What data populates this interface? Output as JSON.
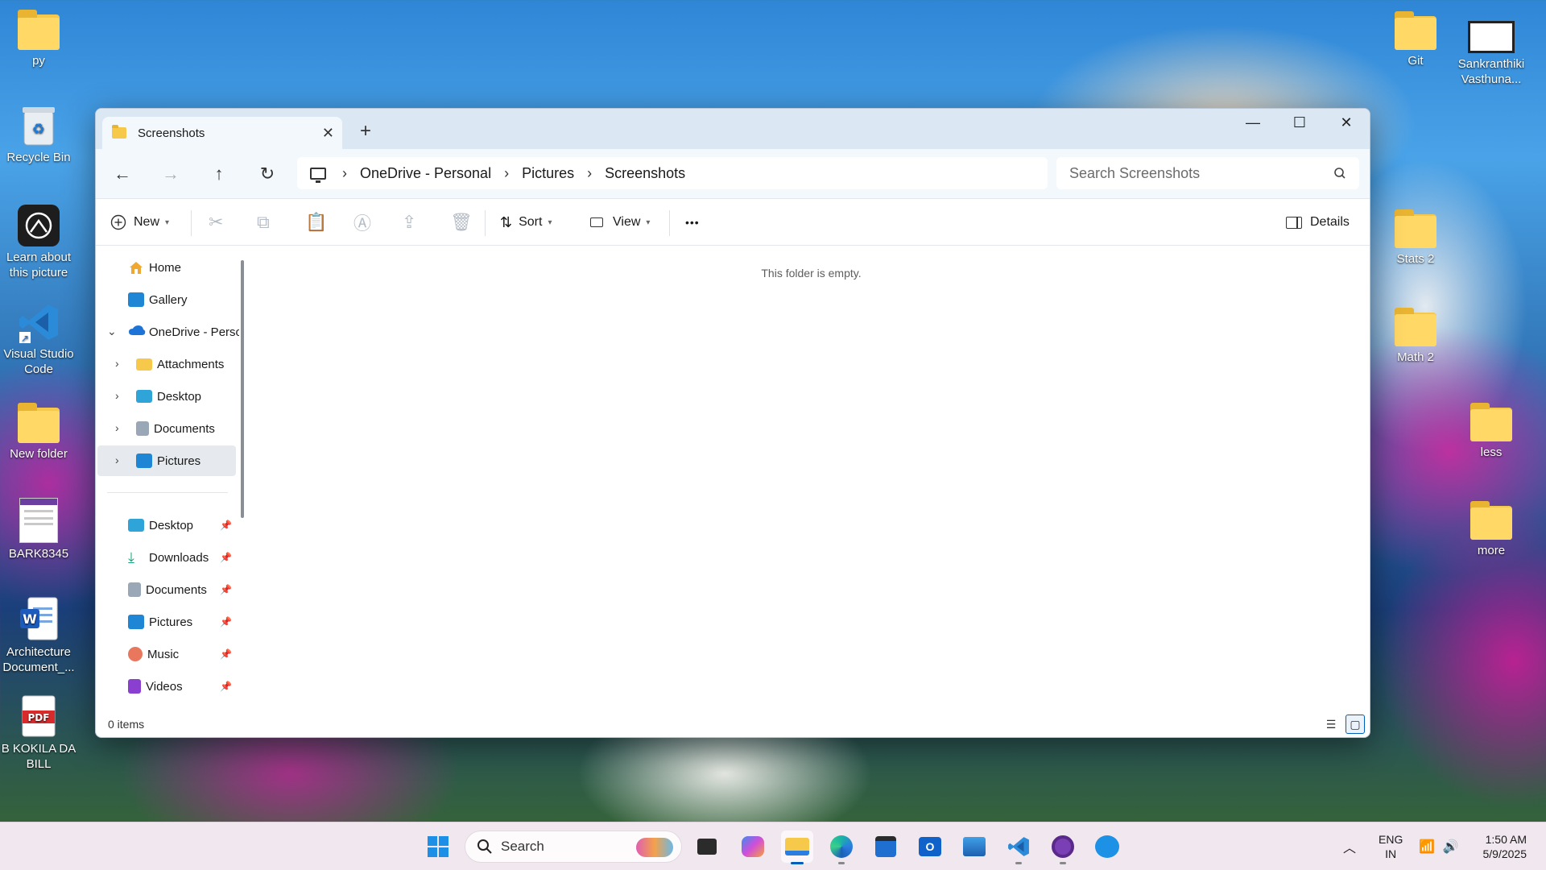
{
  "desktop": {
    "left_icons": [
      {
        "label": "py",
        "icon": "folder-icon"
      },
      {
        "label": "Recycle Bin",
        "icon": "recycle-bin-icon"
      },
      {
        "label": "Learn about this picture",
        "icon": "camera-icon"
      },
      {
        "label": "Visual Studio Code",
        "icon": "vscode-icon"
      },
      {
        "label": "New folder",
        "icon": "folder-icon"
      },
      {
        "label": "BARK8345",
        "icon": "document-thumbnail-icon"
      },
      {
        "label": "Architecture Document_...",
        "icon": "word-icon"
      },
      {
        "label": "B KOKILA DA BILL",
        "icon": "pdf-icon"
      }
    ],
    "right_icons": [
      {
        "label": "Git",
        "icon": "folder-icon"
      },
      {
        "label": "Sankranthiki Vasthuna...",
        "icon": "video-icon"
      },
      {
        "label": "Stats 2",
        "icon": "folder-icon"
      },
      {
        "label": "Math 2",
        "icon": "folder-icon"
      },
      {
        "label": "less",
        "icon": "folder-icon"
      },
      {
        "label": "more",
        "icon": "folder-icon"
      }
    ]
  },
  "window": {
    "tab_title": "Screenshots",
    "new_tab_glyph": "+",
    "breadcrumb": [
      "OneDrive - Personal",
      "Pictures",
      "Screenshots"
    ],
    "search_placeholder": "Search Screenshots",
    "toolbar": {
      "new_label": "New",
      "sort_label": "Sort",
      "view_label": "View",
      "more_glyph": "•••",
      "details_label": "Details"
    },
    "sidebar": {
      "top": [
        {
          "label": "Home",
          "icon": "home-icon"
        },
        {
          "label": "Gallery",
          "icon": "gallery-icon"
        },
        {
          "label": "OneDrive - Personal",
          "icon": "onedrive-icon"
        }
      ],
      "onedrive_children": [
        {
          "label": "Attachments",
          "icon": "folder-icon"
        },
        {
          "label": "Desktop",
          "icon": "desktop-icon"
        },
        {
          "label": "Documents",
          "icon": "documents-icon"
        },
        {
          "label": "Pictures",
          "icon": "pictures-icon"
        }
      ],
      "quick_access": [
        {
          "label": "Desktop",
          "icon": "desktop-icon"
        },
        {
          "label": "Downloads",
          "icon": "downloads-icon"
        },
        {
          "label": "Documents",
          "icon": "documents-icon"
        },
        {
          "label": "Pictures",
          "icon": "pictures-icon"
        },
        {
          "label": "Music",
          "icon": "music-icon"
        },
        {
          "label": "Videos",
          "icon": "videos-icon"
        }
      ]
    },
    "empty_message": "This folder is empty.",
    "status": "0 items"
  },
  "taskbar": {
    "search_label": "Search",
    "apps": [
      "start-icon",
      "task-view-icon",
      "copilot-icon",
      "file-explorer-icon",
      "edge-icon",
      "store-icon",
      "outlook-icon",
      "photos-icon",
      "vscode-icon",
      "github-desktop-icon",
      "docker-icon"
    ],
    "language": "ENG",
    "region": "IN",
    "time": "1:50 AM",
    "date": "5/9/2025"
  },
  "colors": {
    "accent": "#005fb8",
    "folder": "#f6c94a",
    "titlebar": "#dbe7f3"
  }
}
